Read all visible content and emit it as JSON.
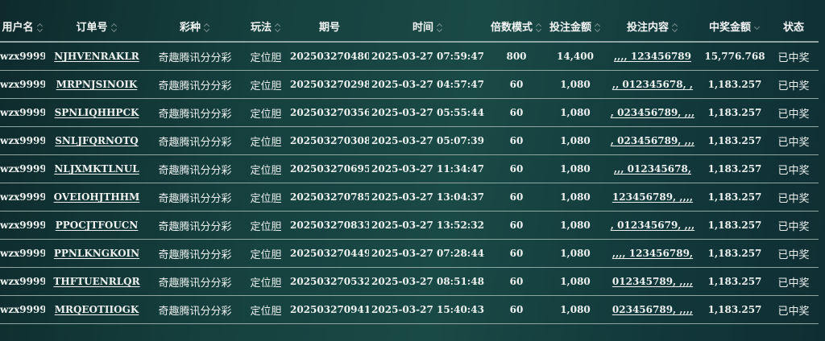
{
  "columns": [
    {
      "label": "用户名",
      "sort": "both"
    },
    {
      "label": "订单号",
      "sort": "both"
    },
    {
      "label": "彩种",
      "sort": "both"
    },
    {
      "label": "玩法",
      "sort": "both"
    },
    {
      "label": "期号",
      "sort": "none"
    },
    {
      "label": "时间",
      "sort": "both"
    },
    {
      "label": "倍数模式",
      "sort": "both"
    },
    {
      "label": "投注金额",
      "sort": "both"
    },
    {
      "label": "投注内容",
      "sort": "both"
    },
    {
      "label": "中奖金额",
      "sort": "desc"
    },
    {
      "label": "状态",
      "sort": "none"
    }
  ],
  "rows": [
    {
      "user": "wzx9999",
      "order": "NJHVENRAKLR",
      "lottery": "奇趣腾讯分分彩",
      "play": "定位胆",
      "issue": "202503270480",
      "time": "2025-03-27 07:59:47",
      "multiplier": "800",
      "bet": "14,400",
      "content": ",,,, 123456789",
      "win": "15,776.768",
      "status": "已中奖"
    },
    {
      "user": "wzx9999",
      "order": "MRPNJSINOIK",
      "lottery": "奇趣腾讯分分彩",
      "play": "定位胆",
      "issue": "202503270298",
      "time": "2025-03-27 04:57:47",
      "multiplier": "60",
      "bet": "1,080",
      "content": ",, 012345678, ,",
      "win": "1,183.257",
      "status": "已中奖"
    },
    {
      "user": "wzx9999",
      "order": "SPNLIQHHPCK",
      "lottery": "奇趣腾讯分分彩",
      "play": "定位胆",
      "issue": "202503270356",
      "time": "2025-03-27 05:55:44",
      "multiplier": "60",
      "bet": "1,080",
      "content": ", 023456789, ,,,",
      "win": "1,183.257",
      "status": "已中奖"
    },
    {
      "user": "wzx9999",
      "order": "SNLJFQRNOTQ",
      "lottery": "奇趣腾讯分分彩",
      "play": "定位胆",
      "issue": "202503270308",
      "time": "2025-03-27 05:07:39",
      "multiplier": "60",
      "bet": "1,080",
      "content": ", 023456789, ,,,",
      "win": "1,183.257",
      "status": "已中奖"
    },
    {
      "user": "wzx9999",
      "order": "NLJXMKTLNUL",
      "lottery": "奇趣腾讯分分彩",
      "play": "定位胆",
      "issue": "202503270695",
      "time": "2025-03-27 11:34:47",
      "multiplier": "60",
      "bet": "1,080",
      "content": ",,, 012345678,",
      "win": "1,183.257",
      "status": "已中奖"
    },
    {
      "user": "wzx9999",
      "order": "OVEIOHJTHHM",
      "lottery": "奇趣腾讯分分彩",
      "play": "定位胆",
      "issue": "202503270785",
      "time": "2025-03-27 13:04:37",
      "multiplier": "60",
      "bet": "1,080",
      "content": "123456789, ,,,,",
      "win": "1,183.257",
      "status": "已中奖"
    },
    {
      "user": "wzx9999",
      "order": "PPOCJTFOUCN",
      "lottery": "奇趣腾讯分分彩",
      "play": "定位胆",
      "issue": "202503270833",
      "time": "2025-03-27 13:52:32",
      "multiplier": "60",
      "bet": "1,080",
      "content": ", 012345679, ,,,",
      "win": "1,183.257",
      "status": "已中奖"
    },
    {
      "user": "wzx9999",
      "order": "PPNLKNGKOIN",
      "lottery": "奇趣腾讯分分彩",
      "play": "定位胆",
      "issue": "202503270449",
      "time": "2025-03-27 07:28:44",
      "multiplier": "60",
      "bet": "1,080",
      "content": ",,,, 123456789,",
      "win": "1,183.257",
      "status": "已中奖"
    },
    {
      "user": "wzx9999",
      "order": "THFTUENRLQR",
      "lottery": "奇趣腾讯分分彩",
      "play": "定位胆",
      "issue": "202503270532",
      "time": "2025-03-27 08:51:48",
      "multiplier": "60",
      "bet": "1,080",
      "content": "012345789, ,,,,",
      "win": "1,183.257",
      "status": "已中奖"
    },
    {
      "user": "wzx9999",
      "order": "MRQEOTIIOGK",
      "lottery": "奇趣腾讯分分彩",
      "play": "定位胆",
      "issue": "202503270941",
      "time": "2025-03-27 15:40:43",
      "multiplier": "60",
      "bet": "1,080",
      "content": "023456789, ,,,,",
      "win": "1,183.257",
      "status": "已中奖"
    }
  ]
}
